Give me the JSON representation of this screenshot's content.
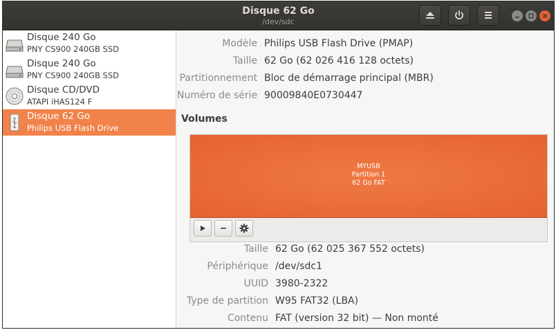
{
  "window": {
    "title": "Disque 62 Go",
    "subtitle": "/dev/sdc"
  },
  "header_buttons": [
    {
      "name": "eject-button",
      "icon": "eject-icon"
    },
    {
      "name": "power-button",
      "icon": "power-icon"
    },
    {
      "name": "menu-button",
      "icon": "hamburger-menu-icon"
    }
  ],
  "sidebar": {
    "drives": [
      {
        "name": "Disque 240 Go",
        "model": "PNY CS900 240GB SSD",
        "icon": "hard-disk-icon",
        "selected": false
      },
      {
        "name": "Disque 240 Go",
        "model": "PNY CS900 240GB SSD",
        "icon": "hard-disk-icon",
        "selected": false
      },
      {
        "name": "Disque CD/DVD",
        "model": "ATAPI   iHAS124   F",
        "icon": "optical-disc-icon",
        "selected": false
      },
      {
        "name": "Disque 62 Go",
        "model": "Philips USB Flash Drive",
        "icon": "usb-drive-icon",
        "selected": true
      }
    ]
  },
  "drive_info": [
    {
      "label": "Modèle",
      "value": "Philips USB Flash Drive (PMAP)"
    },
    {
      "label": "Taille",
      "value": "62 Go (62 026 416 128 octets)"
    },
    {
      "label": "Partitionnement",
      "value": "Bloc de démarrage principal (MBR)"
    },
    {
      "label": "Numéro de série",
      "value": "90009840E0730447"
    }
  ],
  "volumes": {
    "title": "Volumes",
    "partition": {
      "label": "MYUSB",
      "number": "Partition 1",
      "summary": "62 Go FAT",
      "color": "#e8672f"
    },
    "tools": [
      {
        "name": "mount-button",
        "icon": "play-icon"
      },
      {
        "name": "delete-partition-button",
        "icon": "minus-icon"
      },
      {
        "name": "partition-settings-button",
        "icon": "gear-icon"
      }
    ]
  },
  "volume_info": [
    {
      "label": "Taille",
      "value": "62 Go (62 025 367 552 octets)"
    },
    {
      "label": "Périphérique",
      "value": "/dev/sdc1"
    },
    {
      "label": "UUID",
      "value": "3980-2322"
    },
    {
      "label": "Type de partition",
      "value": "W95 FAT32 (LBA)"
    },
    {
      "label": "Contenu",
      "value": "FAT (version 32 bit) — Non monté"
    }
  ],
  "colors": {
    "accent": "#f0824a",
    "headerbar": "#3a3935",
    "close_button": "#e0603a"
  }
}
